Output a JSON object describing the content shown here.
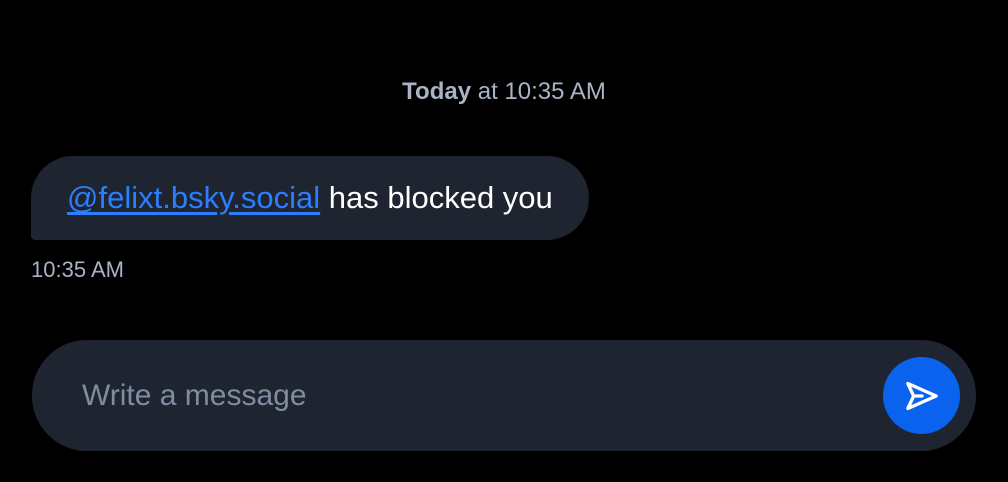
{
  "thread": {
    "date_separator": {
      "day": "Today",
      "time": "at 10:35 AM"
    },
    "messages": [
      {
        "mention": "@felixt.bsky.social",
        "text": " has blocked you",
        "time": "10:35 AM"
      }
    ]
  },
  "composer": {
    "placeholder": "Write a message",
    "send_icon": "send-icon"
  },
  "colors": {
    "background": "#000000",
    "bubble": "#1e2430",
    "link": "#2b7fff",
    "send_button": "#0a63ef",
    "muted_text": "#a8b3c4"
  }
}
